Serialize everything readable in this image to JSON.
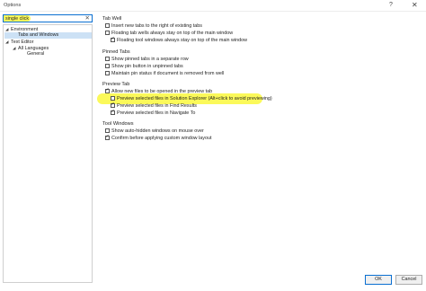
{
  "window": {
    "title": "Options",
    "help_label": "?",
    "close_label": "✕"
  },
  "search": {
    "value": "single click",
    "clear_label": "✕"
  },
  "tree": [
    {
      "label": "Environment",
      "expanded": true
    },
    {
      "label": "Tabs and Windows",
      "selected": true
    },
    {
      "label": "Text Editor",
      "expanded": true
    },
    {
      "label": "All Languages",
      "expanded": true
    },
    {
      "label": "General"
    }
  ],
  "sections": {
    "tab_well": {
      "header": "Tab Well",
      "options": [
        {
          "label": "Insert new tabs to the right of existing tabs",
          "checked": false
        },
        {
          "label": "Floating tab wells always stay on top of the main window",
          "checked": false
        },
        {
          "label": "Floating tool windows always stay on top of the main window",
          "checked": true
        }
      ]
    },
    "pinned_tabs": {
      "header": "Pinned Tabs",
      "options": [
        {
          "label": "Show pinned tabs in a separate row",
          "checked": false
        },
        {
          "label": "Show pin button in unpinned tabs",
          "checked": false
        },
        {
          "label": "Maintain pin status if document is removed from well",
          "checked": false
        }
      ]
    },
    "preview_tab": {
      "header": "Preview Tab",
      "options": [
        {
          "label": "Allow new files to be opened in the preview tab",
          "checked": true
        },
        {
          "label": "Preview selected files in Solution Explorer (Alt+click to avoid previewing)",
          "checked": false
        },
        {
          "label": "Preview selected files in Find Results",
          "checked": true
        },
        {
          "label": "Preview selected files in Navigate To",
          "checked": true
        }
      ]
    },
    "tool_windows": {
      "header": "Tool Windows",
      "options": [
        {
          "label": "Show auto-hidden windows on mouse over",
          "checked": false
        },
        {
          "label": "Confirm before applying custom window layout",
          "checked": true
        }
      ]
    }
  },
  "buttons": {
    "ok": "OK",
    "cancel": "Cancel"
  },
  "colors": {
    "highlight": "#fbf95a",
    "selection": "#cce1f5",
    "accent": "#0a6fd1"
  }
}
